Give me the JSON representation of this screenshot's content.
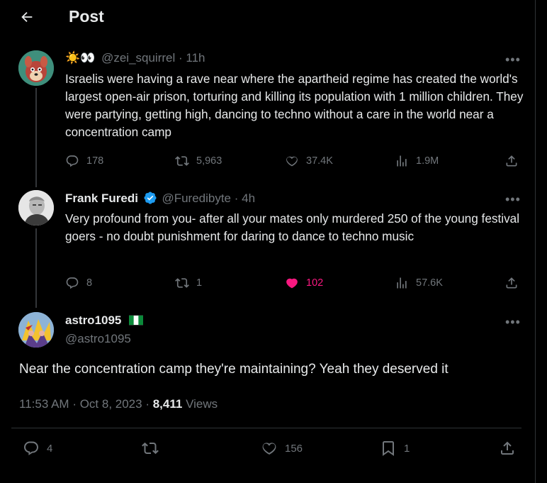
{
  "header": {
    "title": "Post"
  },
  "thread": [
    {
      "name_emoji": "☀️👀",
      "handle": "@zei_squirrel",
      "time": "11h",
      "text": "Israelis were having a rave near where the apartheid regime has created the world's largest open-air prison, torturing and killing its population with 1 million children. They were partying, getting high, dancing to techno without a care in the world near a concentration camp",
      "replies": "178",
      "reposts": "5,963",
      "likes": "37.4K",
      "views": "1.9M"
    },
    {
      "name": "Frank Furedi",
      "verified": true,
      "handle": "@Furedibyte",
      "time": "4h",
      "text": "Very profound from you- after all your mates only murdered 250 of the young festival goers - no doubt punishment for daring to dance to techno music",
      "replies": "8",
      "reposts": "1",
      "likes": "102",
      "liked": true,
      "views": "57.6K"
    }
  ],
  "main": {
    "name": "astro1095",
    "handle": "@astro1095",
    "text": "Near the concentration camp they're maintaining? Yeah they deserved it",
    "time": "11:53 AM",
    "date": "Oct 8, 2023",
    "views_count": "8,411",
    "views_label": "Views",
    "replies": "4",
    "likes": "156",
    "bookmarks": "1"
  },
  "icons": {
    "back": "arrow-left-icon",
    "more": "more-horizontal-icon",
    "reply": "reply-icon",
    "repost": "repost-icon",
    "like": "heart-icon",
    "views": "analytics-icon",
    "share": "share-icon",
    "bookmark": "bookmark-icon",
    "verified": "verified-badge-icon"
  },
  "colors": {
    "background": "#000000",
    "text": "#e7e9ea",
    "muted": "#71767b",
    "like_active": "#f91880",
    "verified": "#1d9bf0",
    "divider": "#2f3336"
  }
}
